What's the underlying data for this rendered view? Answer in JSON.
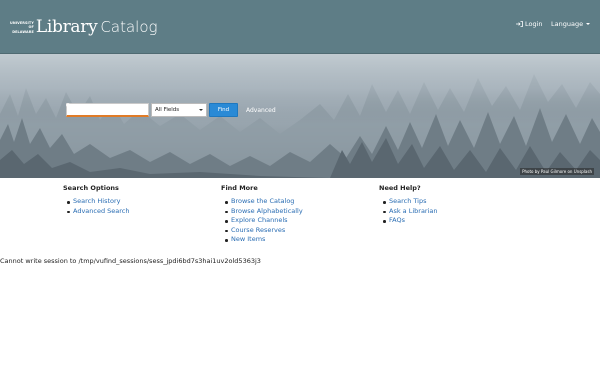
{
  "header": {
    "logo_small_lines": [
      "UNIVERSITY",
      "OF",
      "DELAWARE"
    ],
    "logo_main": "Library",
    "logo_sub": "Catalog",
    "login_label": "Login",
    "language_label": "Language"
  },
  "search": {
    "input_value": "",
    "select_value": "All Fields",
    "find_label": "Find",
    "advanced_label": "Advanced"
  },
  "hero": {
    "photo_credit": "Photo by Paul Gilmore on Unsplash"
  },
  "columns": [
    {
      "title": "Search Options",
      "links": [
        "Search History",
        "Advanced Search"
      ]
    },
    {
      "title": "Find More",
      "links": [
        "Browse the Catalog",
        "Browse Alphabetically",
        "Explore Channels",
        "Course Reserves",
        "New Items"
      ]
    },
    {
      "title": "Need Help?",
      "links": [
        "Search Tips",
        "Ask a Librarian",
        "FAQs"
      ]
    }
  ],
  "error_message": "Cannot write session to /tmp/vufind_sessions/sess_jpdi6bd7s3hai1uv2old5363j3",
  "colors": {
    "header_bg": "#5e7d86",
    "accent": "#2a8ad6",
    "link": "#2a6db3",
    "input_underline": "#e07b26"
  }
}
